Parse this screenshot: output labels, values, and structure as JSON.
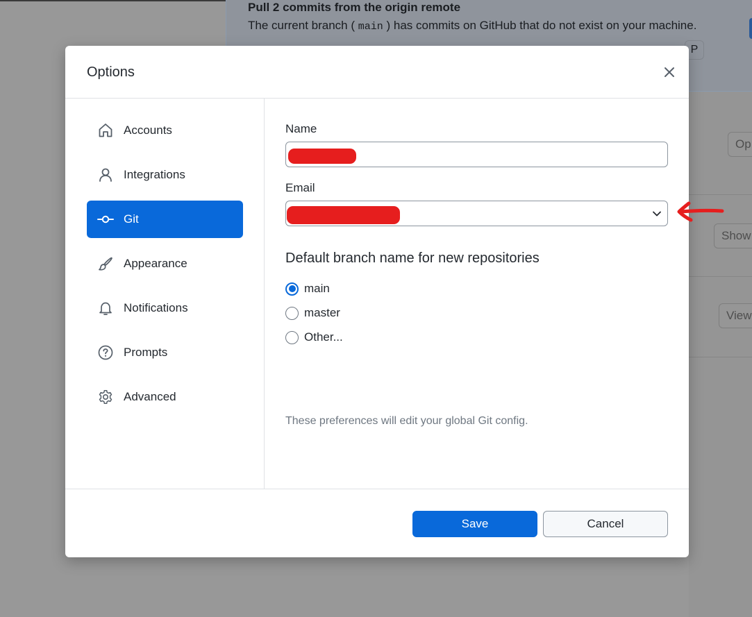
{
  "background": {
    "banner_title": "Pull 2 commits from the origin remote",
    "banner_desc_prefix": "The current branch (",
    "banner_desc_code": "main",
    "banner_desc_suffix": ") has commits on GitHub that do not exist on your machine.",
    "banner_key": "P",
    "side_buttons": [
      "Op",
      "Show",
      "View"
    ]
  },
  "dialog": {
    "title": "Options",
    "close_label": "Close",
    "sidebar": {
      "items": [
        {
          "label": "Accounts",
          "icon": "home-icon",
          "active": false
        },
        {
          "label": "Integrations",
          "icon": "person-icon",
          "active": false
        },
        {
          "label": "Git",
          "icon": "git-commit-icon",
          "active": true
        },
        {
          "label": "Appearance",
          "icon": "paintbrush-icon",
          "active": false
        },
        {
          "label": "Notifications",
          "icon": "bell-icon",
          "active": false
        },
        {
          "label": "Prompts",
          "icon": "question-icon",
          "active": false
        },
        {
          "label": "Advanced",
          "icon": "gear-icon",
          "active": false
        }
      ]
    },
    "git": {
      "name_label": "Name",
      "name_value": "[redacted]",
      "email_label": "Email",
      "email_value": "[redacted]",
      "branch_section_title": "Default branch name for new repositories",
      "branch_options": [
        {
          "label": "main",
          "checked": true
        },
        {
          "label": "master",
          "checked": false
        },
        {
          "label": "Other...",
          "checked": false
        }
      ],
      "hint": "These preferences will edit your global Git config."
    },
    "footer": {
      "save_label": "Save",
      "cancel_label": "Cancel"
    }
  },
  "colors": {
    "accent": "#0969da",
    "annotation": "#e61e1e",
    "overlay": "#989898"
  }
}
